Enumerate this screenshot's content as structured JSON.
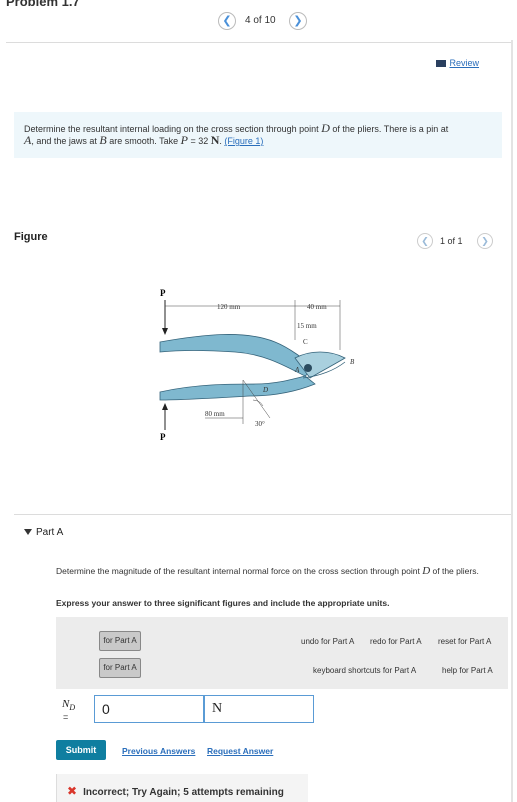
{
  "header": {
    "problem_title": "Problem 1.7",
    "prev_icon": "chevron-left-icon",
    "next_icon": "chevron-right-icon",
    "position": "4 of 10"
  },
  "review": {
    "label": "Review",
    "icon": "book-icon"
  },
  "prompt": {
    "text_1": "Determine the resultant internal loading on the cross section through point ",
    "D": "D",
    "text_2": " of the pliers. There is a pin at ",
    "A": "A",
    "text_3": ", and the jaws at ",
    "B": "B",
    "text_4": " are smooth. Take ",
    "P": "P",
    "text_5": " = 32 ",
    "N": "N",
    "text_6": ". ",
    "figure_link": "(Figure 1)"
  },
  "figure_panel": {
    "label": "Figure",
    "pager": "1 of 1",
    "labels": {
      "P_top": "P",
      "P_bottom": "P",
      "dim_120": "120 mm",
      "dim_40": "40 mm",
      "dim_15": "15 mm",
      "C": "C",
      "A": "A",
      "B": "B",
      "D": "D",
      "dim_80": "80 mm",
      "angle": "30°"
    }
  },
  "part_a": {
    "label": "Part A",
    "question_1": "Determine the magnitude of the resultant internal normal force on the cross section through point ",
    "question_D": "D",
    "question_2": " of the pliers.",
    "instruction": "Express your answer to three significant figures and include the appropriate units.",
    "toolbar": {
      "templates_tool": "for Part A",
      "symbols_tool": "for Part A",
      "undo": "undo for Part A",
      "redo": "redo for Part A",
      "reset": "reset for Part A",
      "help": "help for Part A",
      "shortcuts": "keyboard shortcuts for Part A"
    },
    "variable": "N",
    "variable_sub": "D",
    "equals": "=",
    "value": "0",
    "unit": "N",
    "submit_label": "Submit",
    "previous_answers": "Previous Answers",
    "request_answer": "Request Answer",
    "feedback": "Incorrect; Try Again; 5 attempts remaining"
  },
  "colors": {
    "accent": "#0f7ea0",
    "link": "#2a6ebb",
    "error": "#d9362b",
    "plier": "#7fb8cf"
  }
}
